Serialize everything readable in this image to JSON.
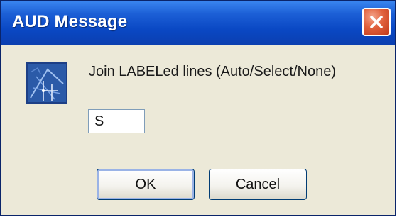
{
  "window": {
    "title": "AUD Message"
  },
  "dialog": {
    "icon": "drawing-app-icon",
    "message": "Join LABELed lines (Auto/Select/None)",
    "input_value": "S"
  },
  "buttons": {
    "ok_label": "OK",
    "cancel_label": "Cancel"
  },
  "colors": {
    "titlebar": "#0a48c4",
    "close_button": "#d9502f",
    "dialog_background": "#ece9d8"
  }
}
